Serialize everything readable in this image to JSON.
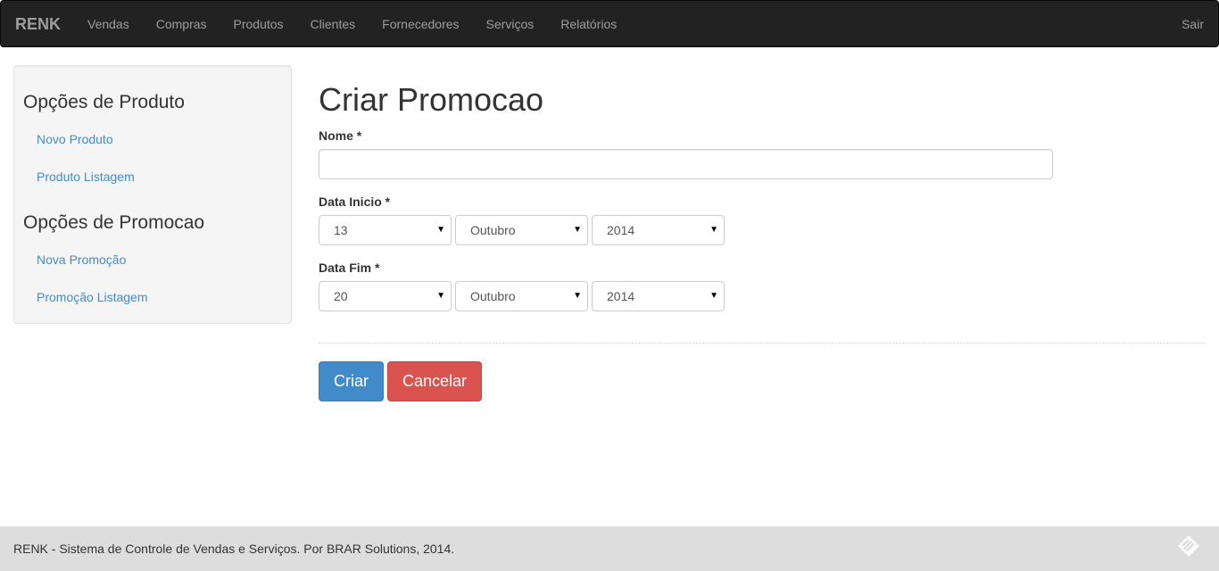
{
  "navbar": {
    "brand": "RENK",
    "items": [
      "Vendas",
      "Compras",
      "Produtos",
      "Clientes",
      "Fornecedores",
      "Serviços",
      "Relatórios"
    ],
    "logout": "Sair"
  },
  "sidebar": {
    "product_heading": "Opções de Produto",
    "product_links": [
      "Novo Produto",
      "Produto Listagem"
    ],
    "promo_heading": "Opções de Promocao",
    "promo_links": [
      "Nova Promoção",
      "Promoção Listagem"
    ]
  },
  "form": {
    "title": "Criar Promocao",
    "name_label": "Nome *",
    "name_value": "",
    "start_label": "Data Inicio *",
    "start_day": "13",
    "start_month": "Outubro",
    "start_year": "2014",
    "end_label": "Data Fim *",
    "end_day": "20",
    "end_month": "Outubro",
    "end_year": "2014",
    "submit_label": "Criar",
    "cancel_label": "Cancelar"
  },
  "footer": {
    "text": "RENK - Sistema de Controle de Vendas e Serviços. Por BRAR Solutions, 2014."
  },
  "colors": {
    "navbar_bg": "#222222",
    "link": "#428bca",
    "primary": "#428bca",
    "danger": "#d9534f",
    "footer_bg": "#dddddd"
  }
}
